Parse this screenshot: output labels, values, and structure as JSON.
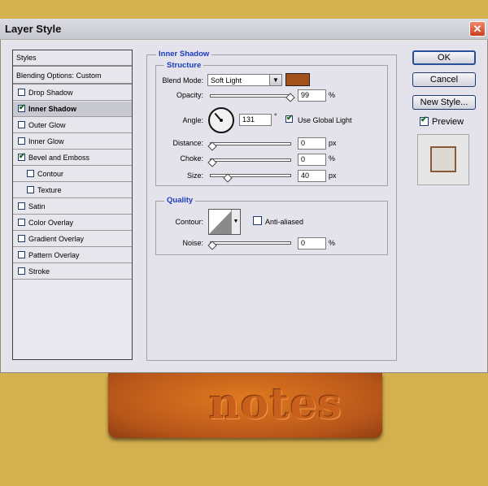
{
  "window": {
    "title": "Layer Style"
  },
  "styles_panel": {
    "header": "Styles",
    "blending": "Blending Options: Custom",
    "items": [
      {
        "label": "Drop Shadow",
        "checked": false,
        "indent": false
      },
      {
        "label": "Inner Shadow",
        "checked": true,
        "indent": false,
        "active": true
      },
      {
        "label": "Outer Glow",
        "checked": false,
        "indent": false
      },
      {
        "label": "Inner Glow",
        "checked": false,
        "indent": false
      },
      {
        "label": "Bevel and Emboss",
        "checked": true,
        "indent": false
      },
      {
        "label": "Contour",
        "checked": false,
        "indent": true
      },
      {
        "label": "Texture",
        "checked": false,
        "indent": true
      },
      {
        "label": "Satin",
        "checked": false,
        "indent": false
      },
      {
        "label": "Color Overlay",
        "checked": false,
        "indent": false
      },
      {
        "label": "Gradient Overlay",
        "checked": false,
        "indent": false
      },
      {
        "label": "Pattern Overlay",
        "checked": false,
        "indent": false
      },
      {
        "label": "Stroke",
        "checked": false,
        "indent": false
      }
    ]
  },
  "inner_shadow": {
    "section_title": "Inner Shadow",
    "structure_title": "Structure",
    "blend_mode_label": "Blend Mode:",
    "blend_mode_value": "Soft Light",
    "shadow_color": "#a3511a",
    "opacity_label": "Opacity:",
    "opacity_value": "99",
    "opacity_unit": "%",
    "opacity_level": 0.99,
    "angle_label": "Angle:",
    "angle_value": "131",
    "angle_unit": "°",
    "use_global_light_label": "Use Global Light",
    "use_global_light": true,
    "distance_label": "Distance:",
    "distance_value": "0",
    "distance_unit": "px",
    "choke_label": "Choke:",
    "choke_value": "0",
    "choke_unit": "%",
    "size_label": "Size:",
    "size_value": "40",
    "size_unit": "px"
  },
  "quality": {
    "title": "Quality",
    "contour_label": "Contour:",
    "anti_aliased_label": "Anti-aliased",
    "anti_aliased": false,
    "noise_label": "Noise:",
    "noise_value": "0",
    "noise_unit": "%"
  },
  "buttons": {
    "ok": "OK",
    "cancel": "Cancel",
    "new_style": "New Style...",
    "preview_label": "Preview",
    "preview_checked": true
  },
  "canvas": {
    "text": "notes",
    "background_color": "#d4b04e"
  }
}
